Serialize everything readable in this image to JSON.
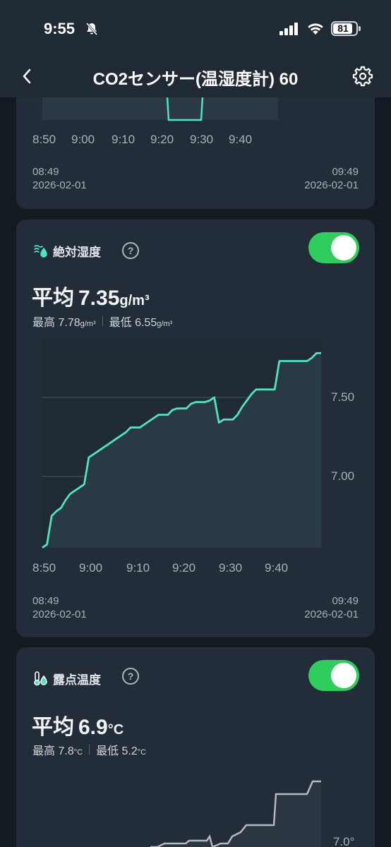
{
  "status_bar": {
    "time": "9:55",
    "battery": "81"
  },
  "header": {
    "title": "CO2センサー(温湿度計) 60"
  },
  "top_card": {
    "x_ticks": [
      "8:50",
      "9:00",
      "9:10",
      "9:20",
      "9:30",
      "9:40"
    ],
    "range_start_time": "08:49",
    "range_start_date": "2026-02-01",
    "range_end_time": "09:49",
    "range_end_date": "2026-02-01"
  },
  "absolute_humidity": {
    "title": "絶対湿度",
    "help": "?",
    "avg_label": "平均",
    "avg_value": "7.35",
    "unit": "g/m³",
    "max_label": "最高",
    "max_value": "7.78",
    "min_label": "最低",
    "min_value": "6.55",
    "toggle_on": true,
    "x_ticks": [
      "8:50",
      "9:00",
      "9:10",
      "9:20",
      "9:30",
      "9:40"
    ],
    "y_ticks": [
      "7.50",
      "7.00"
    ],
    "range_start_time": "08:49",
    "range_start_date": "2026-02-01",
    "range_end_time": "09:49",
    "range_end_date": "2026-02-01"
  },
  "dew_point": {
    "title": "露点温度",
    "help": "?",
    "avg_label": "平均",
    "avg_value": "6.9",
    "unit": "°C",
    "max_label": "最高",
    "max_value": "7.8",
    "min_label": "最低",
    "min_value": "5.2",
    "toggle_on": true,
    "y_ticks": [
      "7.0°"
    ]
  },
  "colors": {
    "accent": "#4fe3c1",
    "toggle": "#2fcc5e",
    "card": "#222d39",
    "background": "#141a21"
  },
  "chart_data": [
    {
      "type": "area",
      "ylabel": "",
      "xlabel": "",
      "ylim": [
        6.55,
        7.78
      ],
      "x_minutes_labels": [
        "8:50",
        "9:00",
        "9:10",
        "9:20",
        "9:30",
        "9:40"
      ],
      "x": [
        "8:49",
        "8:50",
        "8:51",
        "8:52",
        "8:53",
        "8:54",
        "8:55",
        "8:56",
        "8:57",
        "8:58",
        "8:59",
        "9:00",
        "9:01",
        "9:02",
        "9:03",
        "9:04",
        "9:05",
        "9:06",
        "9:07",
        "9:08",
        "9:09",
        "9:10",
        "9:11",
        "9:12",
        "9:13",
        "9:14",
        "9:15",
        "9:16",
        "9:17",
        "9:18",
        "9:19",
        "9:20",
        "9:21",
        "9:22",
        "9:23",
        "9:24",
        "9:25",
        "9:26",
        "9:27",
        "9:28",
        "9:29",
        "9:30",
        "9:31",
        "9:32",
        "9:33",
        "9:34",
        "9:35",
        "9:36",
        "9:37",
        "9:38",
        "9:39",
        "9:40",
        "9:41",
        "9:42",
        "9:43",
        "9:44",
        "9:45",
        "9:46",
        "9:47",
        "9:48",
        "9:49"
      ],
      "values": [
        6.55,
        6.57,
        6.75,
        6.78,
        6.8,
        6.85,
        6.89,
        6.91,
        6.93,
        6.95,
        7.12,
        7.14,
        7.16,
        7.18,
        7.2,
        7.22,
        7.24,
        7.26,
        7.28,
        7.31,
        7.31,
        7.31,
        7.33,
        7.35,
        7.37,
        7.39,
        7.39,
        7.39,
        7.42,
        7.43,
        7.43,
        7.43,
        7.46,
        7.47,
        7.47,
        7.47,
        7.48,
        7.5,
        7.34,
        7.36,
        7.36,
        7.36,
        7.39,
        7.44,
        7.48,
        7.52,
        7.55,
        7.55,
        7.55,
        7.55,
        7.55,
        7.73,
        7.73,
        7.73,
        7.73,
        7.73,
        7.73,
        7.73,
        7.75,
        7.78,
        7.78
      ]
    }
  ]
}
